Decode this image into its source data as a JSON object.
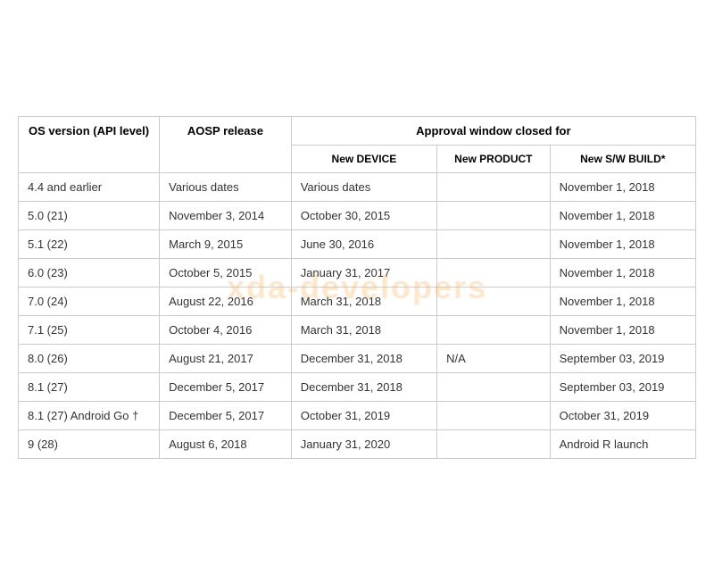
{
  "watermark": "xda-developers",
  "headers": {
    "col1": "OS version (API level)",
    "col2": "AOSP release",
    "col3_group": "Approval window closed for",
    "col3a": "New DEVICE",
    "col3b": "New PRODUCT",
    "col3c": "New S/W BUILD*"
  },
  "rows": [
    {
      "os": "4.4 and earlier",
      "aosp": "Various dates",
      "device": "Various dates",
      "product": "",
      "sw": "November 1, 2018"
    },
    {
      "os": "5.0 (21)",
      "aosp": "November 3, 2014",
      "device": "October 30, 2015",
      "product": "",
      "sw": "November 1, 2018"
    },
    {
      "os": "5.1 (22)",
      "aosp": "March 9, 2015",
      "device": "June 30, 2016",
      "product": "",
      "sw": "November 1, 2018"
    },
    {
      "os": "6.0 (23)",
      "aosp": "October 5, 2015",
      "device": "January 31, 2017",
      "product": "",
      "sw": "November 1, 2018"
    },
    {
      "os": "7.0 (24)",
      "aosp": "August 22, 2016",
      "device": "March 31, 2018",
      "product": "",
      "sw": "November 1, 2018"
    },
    {
      "os": "7.1 (25)",
      "aosp": "October 4, 2016",
      "device": "March 31, 2018",
      "product": "",
      "sw": "November 1, 2018"
    },
    {
      "os": "8.0 (26)",
      "aosp": "August 21, 2017",
      "device": "December 31, 2018",
      "product": "N/A",
      "sw": "September 03, 2019"
    },
    {
      "os": "8.1 (27)",
      "aosp": "December 5, 2017",
      "device": "December 31, 2018",
      "product": "",
      "sw": "September 03, 2019"
    },
    {
      "os": "8.1 (27) Android Go †",
      "aosp": "December 5, 2017",
      "device": "October 31, 2019",
      "product": "",
      "sw": "October 31, 2019"
    },
    {
      "os": "9 (28)",
      "aosp": "August 6, 2018",
      "device": "January 31, 2020",
      "product": "",
      "sw": "Android R launch"
    }
  ]
}
